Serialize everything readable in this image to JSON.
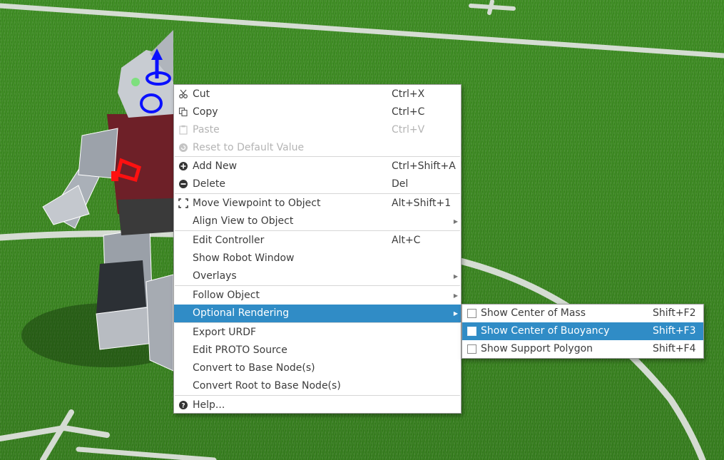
{
  "context_menu": {
    "items": [
      {
        "label": "Cut",
        "shortcut": "Ctrl+X",
        "icon": "scissors-icon",
        "enabled": true
      },
      {
        "label": "Copy",
        "shortcut": "Ctrl+C",
        "icon": "copy-icon",
        "enabled": true
      },
      {
        "label": "Paste",
        "shortcut": "Ctrl+V",
        "icon": "clipboard-icon",
        "enabled": false
      },
      {
        "label": "Reset to Default Value",
        "shortcut": "",
        "icon": "reset-icon",
        "enabled": false
      },
      {
        "label": "Add New",
        "shortcut": "Ctrl+Shift+A",
        "icon": "plus-circle-icon",
        "enabled": true
      },
      {
        "label": "Delete",
        "shortcut": "Del",
        "icon": "minus-circle-icon",
        "enabled": true
      },
      {
        "label": "Move Viewpoint to Object",
        "shortcut": "Alt+Shift+1",
        "icon": "viewpoint-frame-icon",
        "enabled": true
      },
      {
        "label": "Align View to Object",
        "shortcut": "",
        "icon": "",
        "enabled": true,
        "submenu": true
      },
      {
        "label": "Edit Controller",
        "shortcut": "Alt+C",
        "icon": "",
        "enabled": true
      },
      {
        "label": "Show Robot Window",
        "shortcut": "",
        "icon": "",
        "enabled": true
      },
      {
        "label": "Overlays",
        "shortcut": "",
        "icon": "",
        "enabled": true,
        "submenu": true
      },
      {
        "label": "Follow Object",
        "shortcut": "",
        "icon": "",
        "enabled": true,
        "submenu": true
      },
      {
        "label": "Optional Rendering",
        "shortcut": "",
        "icon": "",
        "enabled": true,
        "submenu": true,
        "highlighted": true
      },
      {
        "label": "Export URDF",
        "shortcut": "",
        "icon": "",
        "enabled": true
      },
      {
        "label": "Edit PROTO Source",
        "shortcut": "",
        "icon": "",
        "enabled": true
      },
      {
        "label": "Convert to Base Node(s)",
        "shortcut": "",
        "icon": "",
        "enabled": true
      },
      {
        "label": "Convert Root to Base Node(s)",
        "shortcut": "",
        "icon": "",
        "enabled": true
      },
      {
        "label": "Help...",
        "shortcut": "",
        "icon": "help-icon",
        "enabled": true
      }
    ]
  },
  "optional_rendering_submenu": {
    "items": [
      {
        "label": "Show Center of Mass",
        "shortcut": "Shift+F2",
        "checked": false
      },
      {
        "label": "Show Center of Buoyancy",
        "shortcut": "Shift+F3",
        "checked": false,
        "highlighted": true
      },
      {
        "label": "Show Support Polygon",
        "shortcut": "Shift+F4",
        "checked": false
      }
    ]
  },
  "colors": {
    "highlight": "#308cc6",
    "grass": "#3d8a22",
    "field_line": "#e8e8e8",
    "disabled_text": "#b4b4b4"
  }
}
